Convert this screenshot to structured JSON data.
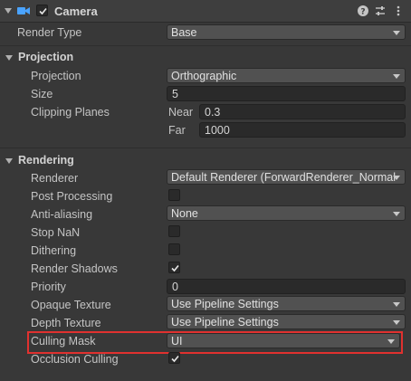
{
  "header": {
    "title": "Camera",
    "enabled": true,
    "icons": [
      "camera-icon",
      "help-icon",
      "presets-icon",
      "menu-icon"
    ]
  },
  "render_type": {
    "label": "Render Type",
    "value": "Base"
  },
  "projection_section": {
    "label": "Projection",
    "projection": {
      "label": "Projection",
      "value": "Orthographic"
    },
    "size": {
      "label": "Size",
      "value": "5"
    },
    "clipping_planes": {
      "label": "Clipping Planes",
      "near_label": "Near",
      "near_value": "0.3",
      "far_label": "Far",
      "far_value": "1000"
    }
  },
  "rendering_section": {
    "label": "Rendering",
    "renderer": {
      "label": "Renderer",
      "value": "Default Renderer (ForwardRenderer_Normal"
    },
    "post_processing": {
      "label": "Post Processing",
      "checked": false
    },
    "anti_aliasing": {
      "label": "Anti-aliasing",
      "value": "None"
    },
    "stop_nan": {
      "label": "Stop NaN",
      "checked": false
    },
    "dithering": {
      "label": "Dithering",
      "checked": false
    },
    "render_shadows": {
      "label": "Render Shadows",
      "checked": true
    },
    "priority": {
      "label": "Priority",
      "value": "0"
    },
    "opaque_texture": {
      "label": "Opaque Texture",
      "value": "Use Pipeline Settings"
    },
    "depth_texture": {
      "label": "Depth Texture",
      "value": "Use Pipeline Settings"
    },
    "culling_mask": {
      "label": "Culling Mask",
      "value": "UI"
    },
    "occlusion_culling": {
      "label": "Occlusion Culling",
      "checked": true
    }
  },
  "colors": {
    "background": "#383838",
    "field": "#2a2a2a",
    "dropdown": "#515151",
    "highlight": "#e0312f"
  }
}
